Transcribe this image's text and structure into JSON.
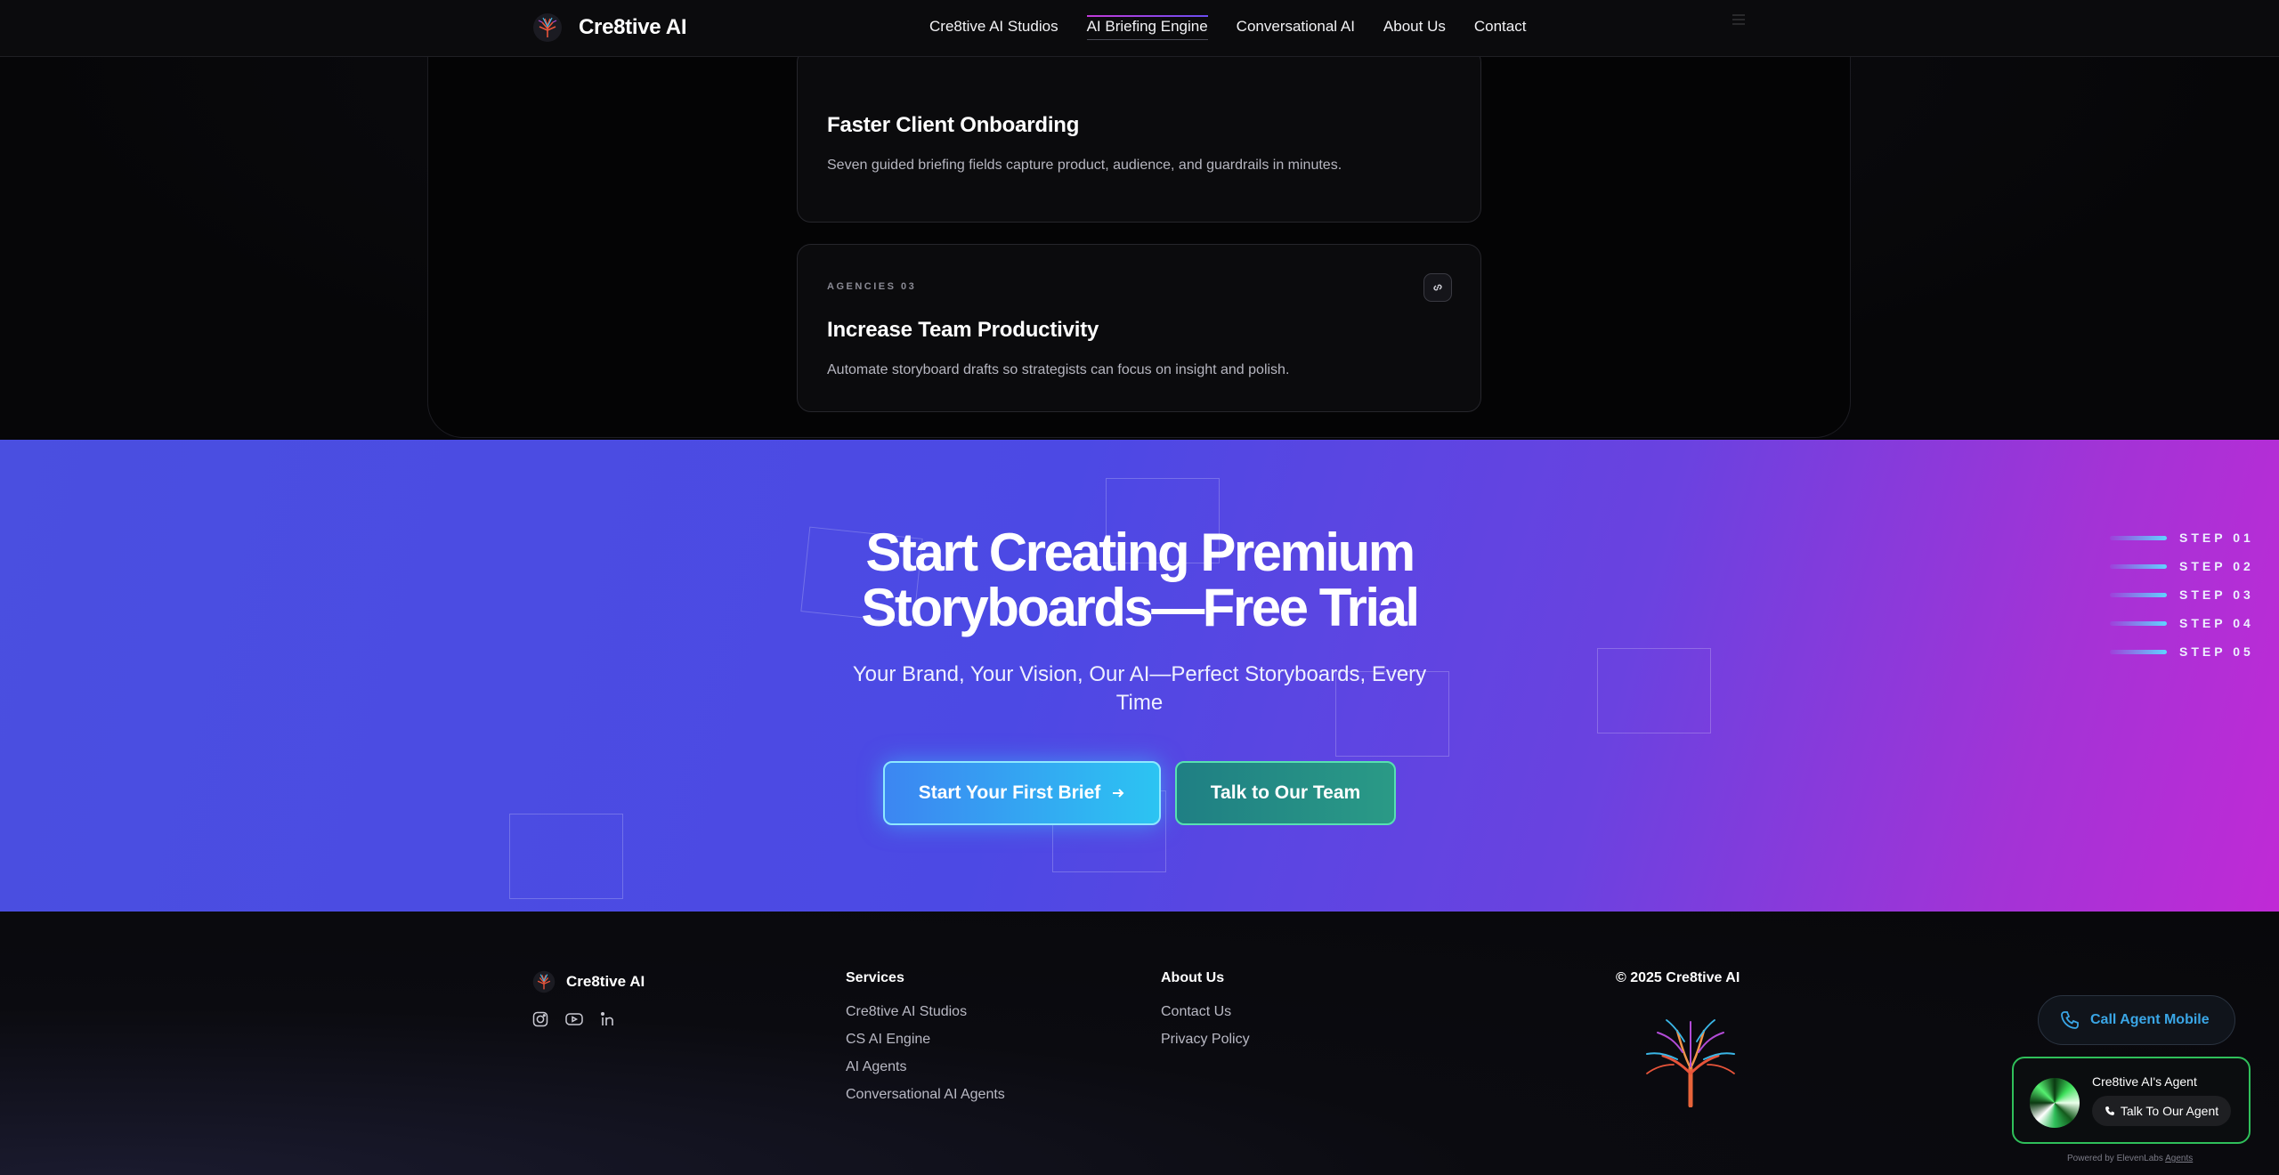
{
  "header": {
    "brand": "Cre8tive AI",
    "nav": [
      {
        "label": "Cre8tive AI Studios"
      },
      {
        "label": "AI Briefing Engine"
      },
      {
        "label": "Conversational AI"
      },
      {
        "label": "About Us"
      },
      {
        "label": "Contact"
      }
    ]
  },
  "cards": [
    {
      "title": "Faster Client Onboarding",
      "description": "Seven guided briefing fields capture product, audience, and guardrails in minutes."
    },
    {
      "tag": "AGENCIES 03",
      "title": "Increase Team Productivity",
      "description": "Automate storyboard drafts so strategists can focus on insight and polish.",
      "icon": "link-icon"
    }
  ],
  "cta": {
    "title_line1": "Start Creating Premium",
    "title_line2": "Storyboards—Free Trial",
    "subtitle": "Your Brand, Your Vision, Our AI—Perfect Storyboards, Every Time",
    "primary_button": "Start Your First Brief",
    "secondary_button": "Talk to Our Team",
    "steps": [
      "STEP 01",
      "STEP 02",
      "STEP 03",
      "STEP 04",
      "STEP 05"
    ]
  },
  "footer": {
    "brand": "Cre8tive AI",
    "social_icons": [
      "instagram-icon",
      "youtube-icon",
      "linkedin-icon"
    ],
    "services_heading": "Services",
    "services": [
      "Cre8tive AI Studios",
      "CS AI Engine",
      "AI Agents",
      "Conversational AI Agents"
    ],
    "about_heading": "About Us",
    "about_links": [
      "Contact Us",
      "Privacy Policy"
    ],
    "copyright": "© 2025 Cre8tive AI"
  },
  "widgets": {
    "call_mobile": "Call Agent Mobile",
    "agent_title": "Cre8tive AI's Agent",
    "agent_button": "Talk To Our Agent",
    "powered_prefix": "Powered by ElevenLabs",
    "powered_link": "Agents"
  },
  "colors": {
    "cta_gradient_start": "#4a4fe0",
    "cta_gradient_end": "#c02ad6",
    "primary_button": "#2cc4f2",
    "secondary_button": "#2a9a86",
    "agent_accent": "#2fbf5a",
    "call_link": "#3aa6e6"
  }
}
